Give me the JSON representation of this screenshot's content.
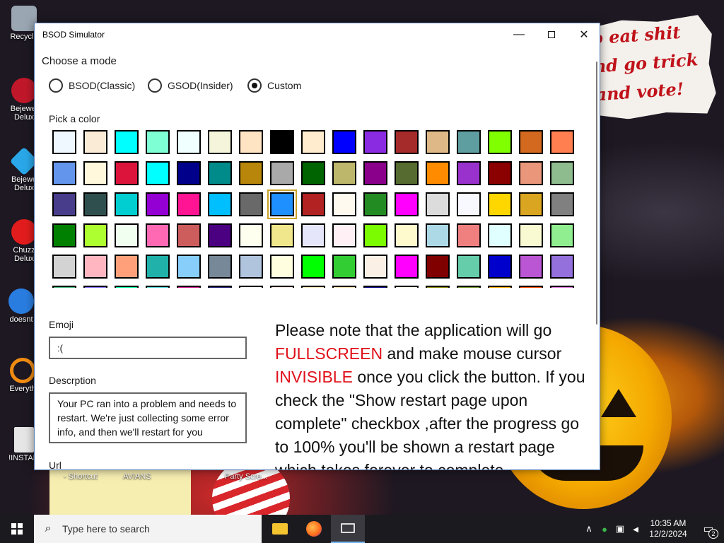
{
  "desktop": {
    "icons": [
      {
        "label": "Recycle",
        "color": "#9aa6b2"
      },
      {
        "label": "Bejewel Delux",
        "color": "#c0182a"
      },
      {
        "label": "Bejewe Delux",
        "color": "#2aa7e8"
      },
      {
        "label": "Chuzz Delux",
        "color": "#e21c1c"
      },
      {
        "label": "doesnt",
        "color": "#2a7de0"
      },
      {
        "label": "Everyth",
        "color": "#f08c12"
      },
      {
        "label": "!INSTALI",
        "color": "#e6e6e6"
      }
    ],
    "captions": [
      "- Shortcut",
      "AVIANS",
      "Party Scre..."
    ],
    "note_lines": [
      "o eat shit",
      "nd go trick",
      "and vote!"
    ]
  },
  "window": {
    "title": "BSOD Simulator",
    "mode_heading": "Choose a mode",
    "modes": [
      {
        "label": "BSOD(Classic)",
        "selected": false
      },
      {
        "label": "GSOD(Insider)",
        "selected": false
      },
      {
        "label": "Custom",
        "selected": true
      }
    ],
    "color_heading": "Pick a color",
    "selected_color": "#1E90FF",
    "colors": [
      [
        "#F0F8FF",
        "#FAEBD7",
        "#00FFFF",
        "#7FFFD4",
        "#F0FFFF",
        "#F5F5DC",
        "#FFE4C4",
        "#000000",
        "#FFEBCD",
        "#0000FF",
        "#8A2BE2",
        "#A52A2A",
        "#DEB887",
        "#5F9EA0",
        "#7FFF00",
        "#D2691E",
        "#FF7F50"
      ],
      [
        "#6495ED",
        "#FFF8DC",
        "#DC143C",
        "#00FFFF",
        "#00008B",
        "#008B8B",
        "#B8860B",
        "#A9A9A9",
        "#006400",
        "#BDB76B",
        "#8B008B",
        "#556B2F",
        "#FF8C00",
        "#9932CC",
        "#8B0000",
        "#E9967A",
        "#8FBC8F"
      ],
      [
        "#483D8B",
        "#2F4F4F",
        "#00CED1",
        "#9400D3",
        "#FF1493",
        "#00BFFF",
        "#696969",
        "#1E90FF",
        "#B22222",
        "#FFFAF0",
        "#228B22",
        "#FF00FF",
        "#DCDCDC",
        "#F8F8FF",
        "#FFD700",
        "#DAA520",
        "#808080"
      ],
      [
        "#008000",
        "#ADFF2F",
        "#F0FFF0",
        "#FF69B4",
        "#CD5C5C",
        "#4B0082",
        "#FFFFF0",
        "#F0E68C",
        "#E6E6FA",
        "#FFF0F5",
        "#7CFC00",
        "#FFFACD",
        "#ADD8E6",
        "#F08080",
        "#E0FFFF",
        "#FAFAD2",
        "#90EE90"
      ],
      [
        "#D3D3D3",
        "#FFB6C1",
        "#FFA07A",
        "#20B2AA",
        "#87CEFA",
        "#778899",
        "#B0C4DE",
        "#FFFFE0",
        "#00FF00",
        "#32CD32",
        "#FAF0E6",
        "#FF00FF",
        "#800000",
        "#66CDAA",
        "#0000CD",
        "#BA55D3",
        "#9370DB"
      ],
      [
        "#3CB371",
        "#7B68EE",
        "#00FA9A",
        "#48D1CC",
        "#C71585",
        "#191970",
        "#F5FFFA",
        "#FFE4E1",
        "#FFE4B5",
        "#FFDEAD",
        "#000080",
        "#FDF5E6",
        "#808000",
        "#6B8E23",
        "#FFA500",
        "#FF4500",
        "#DA70D6"
      ]
    ],
    "emoji_label": "Emoji",
    "emoji_value": ":(",
    "desc_label": "Descrption",
    "desc_value": "Your PC ran into a problem and needs to restart. We're just collecting some error info, and then we'll restart for you",
    "url_label": "Url",
    "notice": {
      "p1": "Please note that the application will go ",
      "fullscreen": "FULLSCREEN",
      "p2": " and make mouse cursor ",
      "invisible": "INVISIBLE",
      "p3": " once you click the button. If you check the \"Show restart page upon complete\" checkbox ,after the progress go to 100% you'll be shown a restart page which takes forever to complete"
    }
  },
  "taskbar": {
    "search_placeholder": "Type here to search",
    "time": "10:35 AM",
    "date": "12/2/2024",
    "notifications": "2"
  }
}
